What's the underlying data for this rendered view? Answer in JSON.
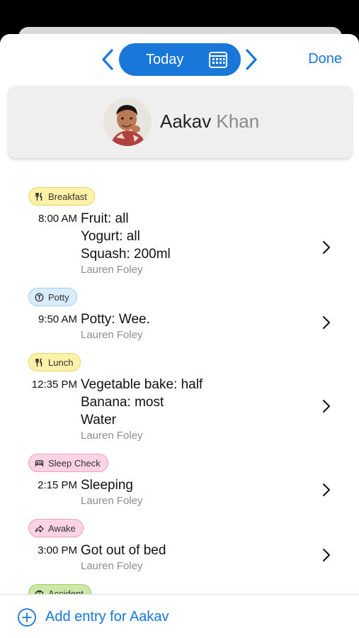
{
  "nav": {
    "date_label": "Today",
    "done_label": "Done"
  },
  "child": {
    "first_name": "Aakav",
    "last_name": "Khan"
  },
  "entries": [
    {
      "category": "Breakfast",
      "icon": "fork-knife-icon",
      "badge_color": "#fdf2a8",
      "badge_border": "#e7d56a",
      "time": "8:00 AM",
      "lines": [
        "Fruit: all",
        "Yogurt: all",
        "Squash: 200ml"
      ],
      "author": "Lauren Foley"
    },
    {
      "category": "Potty",
      "icon": "potty-icon",
      "badge_color": "#d9ecfb",
      "badge_border": "#a9cdec",
      "time": "9:50 AM",
      "lines": [
        "Potty: Wee."
      ],
      "author": "Lauren Foley"
    },
    {
      "category": "Lunch",
      "icon": "fork-knife-icon",
      "badge_color": "#fdf2a8",
      "badge_border": "#e7d56a",
      "time": "12:35 PM",
      "lines": [
        "Vegetable bake: half",
        "Banana: most",
        "Water"
      ],
      "author": "Lauren Foley"
    },
    {
      "category": "Sleep Check",
      "icon": "bed-icon",
      "badge_color": "#fbd3e2",
      "badge_border": "#ee9fbd",
      "time": "2:15 PM",
      "lines": [
        "Sleeping"
      ],
      "author": "Lauren Foley"
    },
    {
      "category": "Awake",
      "icon": "arrow-share-icon",
      "badge_color": "#fbd3e2",
      "badge_border": "#ee9fbd",
      "time": "3:00 PM",
      "lines": [
        "Got out of bed"
      ],
      "author": "Lauren Foley"
    },
    {
      "category": "Accident",
      "icon": "first-aid-icon",
      "badge_color": "#cde9a7",
      "badge_border": "#9ccd6a",
      "time": "",
      "lines": [],
      "author": ""
    }
  ],
  "bottom": {
    "add_label": "Add entry for Aakav"
  },
  "colors": {
    "accent": "#1877d8",
    "secondary_text": "#8e8e8e"
  }
}
